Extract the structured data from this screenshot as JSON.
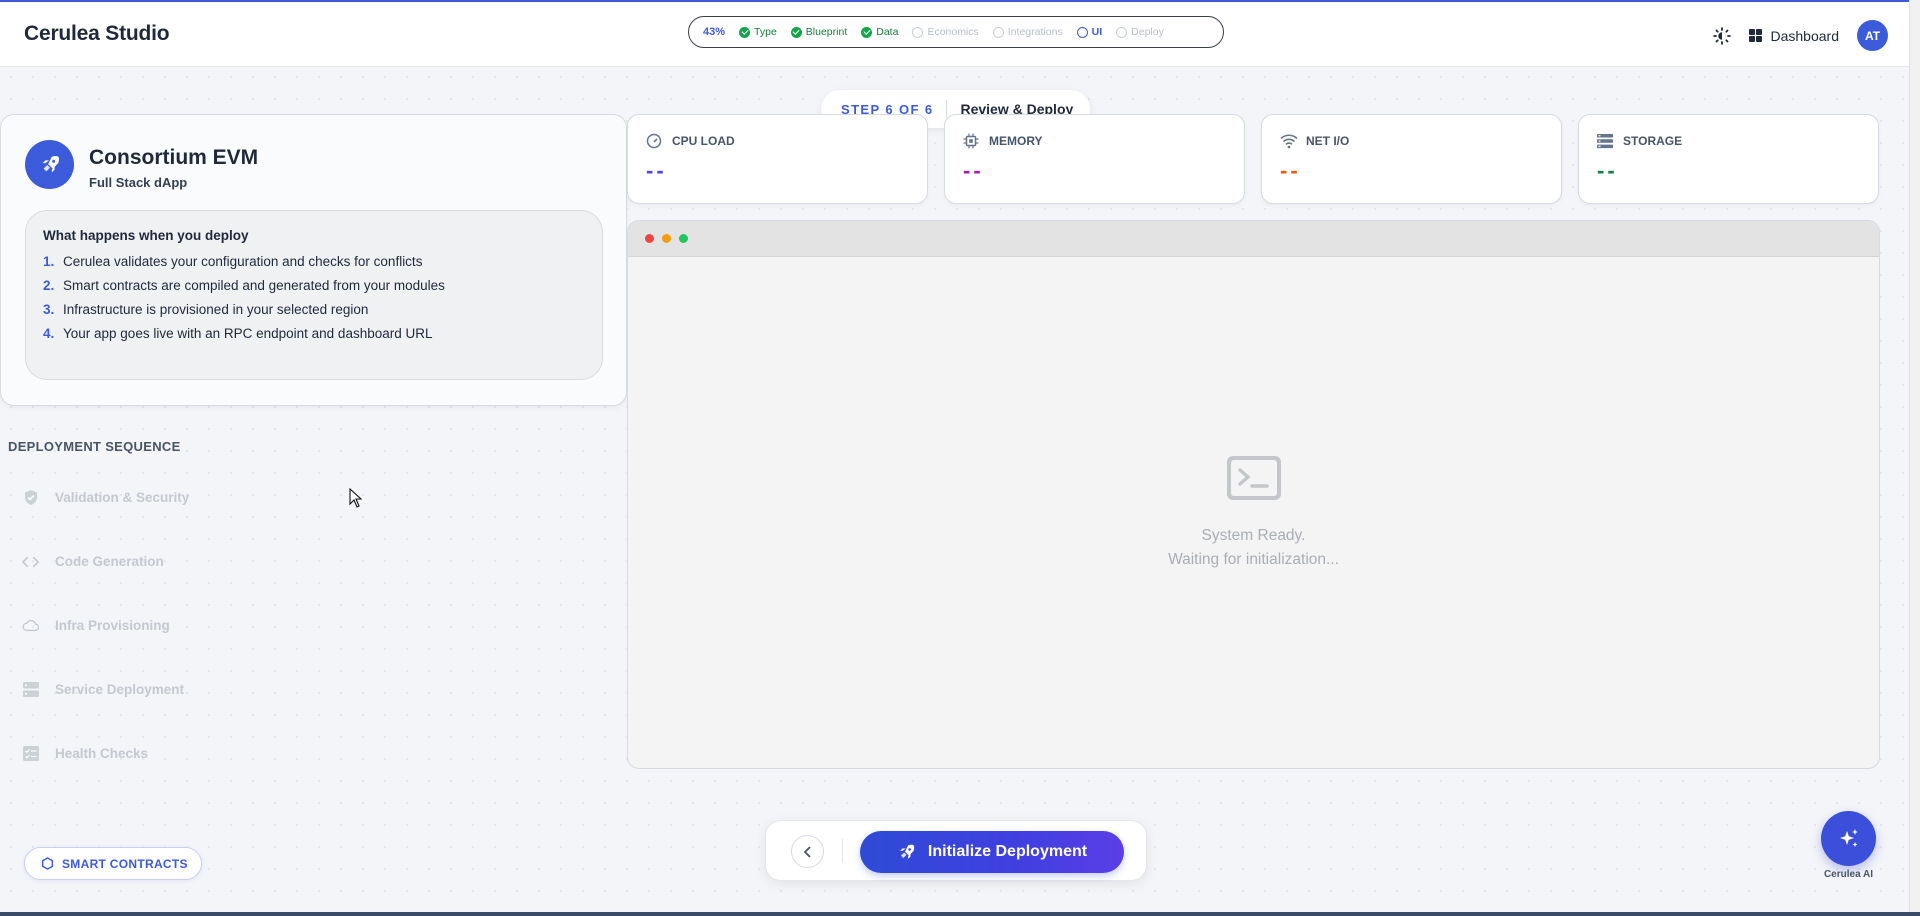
{
  "app": {
    "brand": "Cerulea Studio"
  },
  "progress": {
    "percent_label": "43%",
    "percent": 43,
    "steps": [
      {
        "label": "Type",
        "state": "done"
      },
      {
        "label": "Blueprint",
        "state": "done"
      },
      {
        "label": "Data",
        "state": "done"
      },
      {
        "label": "Economics",
        "state": "pending"
      },
      {
        "label": "Integrations",
        "state": "pending"
      },
      {
        "label": "UI",
        "state": "current"
      },
      {
        "label": "Deploy",
        "state": "pending"
      }
    ]
  },
  "header": {
    "theme_icon": "theme-toggle-icon",
    "dashboard_label": "Dashboard",
    "avatar_initials": "AT"
  },
  "step_badge": {
    "step": "STEP 6 OF 6",
    "title": "Review & Deploy"
  },
  "project": {
    "name": "Consortium EVM",
    "type": "Full Stack dApp",
    "explainer_title": "What happens when you deploy",
    "explainer_steps": [
      {
        "num": "1.",
        "text": "Cerulea validates your configuration and checks for conflicts"
      },
      {
        "num": "2.",
        "text": "Smart contracts are compiled and generated from your modules"
      },
      {
        "num": "3.",
        "text": "Infrastructure is provisioned in your selected region"
      },
      {
        "num": "4.",
        "text": "Your app goes live with an RPC endpoint and dashboard URL"
      }
    ]
  },
  "sequence": {
    "title": "DEPLOYMENT SEQUENCE",
    "items": [
      {
        "label": "Validation & Security",
        "icon": "shield-icon"
      },
      {
        "label": "Code Generation",
        "icon": "code-icon"
      },
      {
        "label": "Infra Provisioning",
        "icon": "cloud-icon"
      },
      {
        "label": "Service Deployment",
        "icon": "server-icon"
      },
      {
        "label": "Health Checks",
        "icon": "checklist-icon"
      }
    ]
  },
  "metrics": [
    {
      "label": "CPU LOAD",
      "value": "--",
      "color": "#4f46e5",
      "icon": "gauge-icon"
    },
    {
      "label": "MEMORY",
      "value": "--",
      "color": "#a21caf",
      "icon": "chip-icon"
    },
    {
      "label": "NET I/O",
      "value": "--",
      "color": "#ea580c",
      "icon": "wifi-icon"
    },
    {
      "label": "STORAGE",
      "value": "--",
      "color": "#15803d",
      "icon": "database-icon"
    }
  ],
  "terminal": {
    "status_line1": "System Ready.",
    "status_line2": "Waiting for initialization..."
  },
  "actions": {
    "back_icon": "chevron-left-icon",
    "init_label": "Initialize Deployment"
  },
  "footer": {
    "smart_contracts_label": "SMART CONTRACTS",
    "ai_label": "Cerulea AI"
  },
  "colors": {
    "accent": "#3b5bdb",
    "success": "#16a34a"
  }
}
